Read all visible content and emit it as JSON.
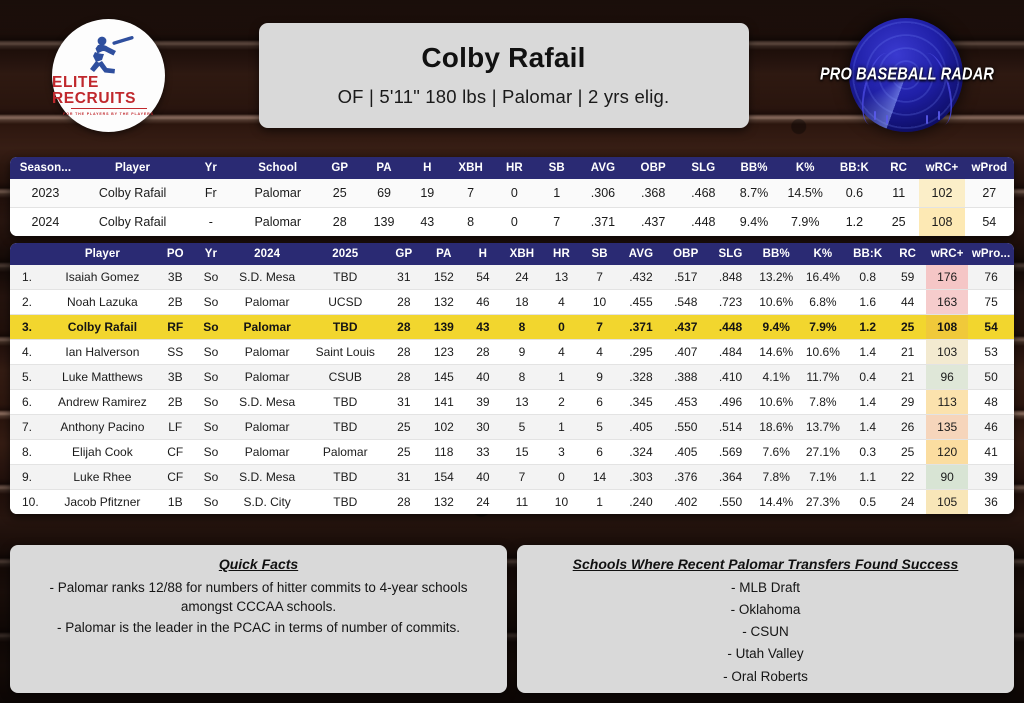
{
  "header": {
    "player_name": "Colby Rafail",
    "player_meta": "OF  |  5'11\"  180 lbs  |  Palomar  | 2 yrs elig.",
    "left_logo": {
      "title": "ELITE RECRUITS",
      "tagline": "FOR THE PLAYERS BY THE PLAYERS"
    },
    "right_logo": {
      "title": "PRO BASEBALL RADAR"
    }
  },
  "season_table": {
    "columns": [
      "Season...",
      "Player",
      "Yr",
      "School",
      "GP",
      "PA",
      "H",
      "XBH",
      "HR",
      "SB",
      "AVG",
      "OBP",
      "SLG",
      "BB%",
      "K%",
      "BB:K",
      "RC",
      "wRC+",
      "wProd"
    ],
    "rows": [
      {
        "cells": [
          "2023",
          "Colby Rafail",
          "Fr",
          "Palomar",
          "25",
          "69",
          "19",
          "7",
          "0",
          "1",
          ".306",
          ".368",
          ".468",
          "8.7%",
          "14.5%",
          "0.6",
          "11",
          "102",
          "27"
        ],
        "wrc_color": "#fbeec8"
      },
      {
        "cells": [
          "2024",
          "Colby Rafail",
          "-",
          "Palomar",
          "28",
          "139",
          "43",
          "8",
          "0",
          "7",
          ".371",
          ".437",
          ".448",
          "9.4%",
          "7.9%",
          "1.2",
          "25",
          "108",
          "54"
        ],
        "wrc_color": "#fde9b4"
      }
    ]
  },
  "rank_table": {
    "columns": [
      "",
      "Player",
      "PO",
      "Yr",
      "2024",
      "2025",
      "GP",
      "PA",
      "H",
      "XBH",
      "HR",
      "SB",
      "AVG",
      "OBP",
      "SLG",
      "BB%",
      "K%",
      "BB:K",
      "RC",
      "wRC+",
      "wPro..."
    ],
    "rows": [
      {
        "highlight": false,
        "wrc_color": "#f5c6c6",
        "cells": [
          "1.",
          "Isaiah Gomez",
          "3B",
          "So",
          "S.D. Mesa",
          "TBD",
          "31",
          "152",
          "54",
          "24",
          "13",
          "7",
          ".432",
          ".517",
          ".848",
          "13.2%",
          "16.4%",
          "0.8",
          "59",
          "176",
          "76"
        ]
      },
      {
        "highlight": false,
        "wrc_color": "#f6cccc",
        "cells": [
          "2.",
          "Noah Lazuka",
          "2B",
          "So",
          "Palomar",
          "UCSD",
          "28",
          "132",
          "46",
          "18",
          "4",
          "10",
          ".455",
          ".548",
          ".723",
          "10.6%",
          "6.8%",
          "1.6",
          "44",
          "163",
          "75"
        ]
      },
      {
        "highlight": true,
        "wrc_color": "#f0c93a",
        "cells": [
          "3.",
          "Colby Rafail",
          "RF",
          "So",
          "Palomar",
          "TBD",
          "28",
          "139",
          "43",
          "8",
          "0",
          "7",
          ".371",
          ".437",
          ".448",
          "9.4%",
          "7.9%",
          "1.2",
          "25",
          "108",
          "54"
        ]
      },
      {
        "highlight": false,
        "wrc_color": "#f3ead0",
        "cells": [
          "4.",
          "Ian Halverson",
          "SS",
          "So",
          "Palomar",
          "Saint Louis",
          "28",
          "123",
          "28",
          "9",
          "4",
          "4",
          ".295",
          ".407",
          ".484",
          "14.6%",
          "10.6%",
          "1.4",
          "21",
          "103",
          "53"
        ]
      },
      {
        "highlight": false,
        "wrc_color": "#dfe7d8",
        "cells": [
          "5.",
          "Luke Matthews",
          "3B",
          "So",
          "Palomar",
          "CSUB",
          "28",
          "145",
          "40",
          "8",
          "1",
          "9",
          ".328",
          ".388",
          ".410",
          "4.1%",
          "11.7%",
          "0.4",
          "21",
          "96",
          "50"
        ]
      },
      {
        "highlight": false,
        "wrc_color": "#fbe2ad",
        "cells": [
          "6.",
          "Andrew Ramirez",
          "2B",
          "So",
          "S.D. Mesa",
          "TBD",
          "31",
          "141",
          "39",
          "13",
          "2",
          "6",
          ".345",
          ".453",
          ".496",
          "10.6%",
          "7.8%",
          "1.4",
          "29",
          "113",
          "48"
        ]
      },
      {
        "highlight": false,
        "wrc_color": "#f6d5bb",
        "cells": [
          "7.",
          "Anthony Pacino",
          "LF",
          "So",
          "Palomar",
          "TBD",
          "25",
          "102",
          "30",
          "5",
          "1",
          "5",
          ".405",
          ".550",
          ".514",
          "18.6%",
          "13.7%",
          "1.4",
          "26",
          "135",
          "46"
        ]
      },
      {
        "highlight": false,
        "wrc_color": "#fbdda0",
        "cells": [
          "8.",
          "Elijah Cook",
          "CF",
          "So",
          "Palomar",
          "Palomar",
          "25",
          "118",
          "33",
          "15",
          "3",
          "6",
          ".324",
          ".405",
          ".569",
          "7.6%",
          "27.1%",
          "0.3",
          "25",
          "120",
          "41"
        ]
      },
      {
        "highlight": false,
        "wrc_color": "#d8e4d4",
        "cells": [
          "9.",
          "Luke Rhee",
          "CF",
          "So",
          "S.D. Mesa",
          "TBD",
          "31",
          "154",
          "40",
          "7",
          "0",
          "14",
          ".303",
          ".376",
          ".364",
          "7.8%",
          "7.1%",
          "1.1",
          "22",
          "90",
          "39"
        ]
      },
      {
        "highlight": false,
        "wrc_color": "#f8e6b8",
        "cells": [
          "10.",
          "Jacob Pfitzner",
          "1B",
          "So",
          "S.D. City",
          "TBD",
          "28",
          "132",
          "24",
          "11",
          "10",
          "1",
          ".240",
          ".402",
          ".550",
          "14.4%",
          "27.3%",
          "0.5",
          "24",
          "105",
          "36"
        ]
      }
    ]
  },
  "quick_facts": {
    "title": "Quick Facts",
    "lines": [
      "- Palomar ranks 12/88 for numbers of hitter commits to 4-year schools amongst CCCAA schools.",
      "- Palomar is the leader in the PCAC in terms of number of commits."
    ]
  },
  "transfers": {
    "title": "Schools Where Recent Palomar Transfers Found Success",
    "lines": [
      "- MLB Draft",
      "- Oklahoma",
      "- CSUN",
      "- Utah Valley",
      "- Oral Roberts"
    ]
  }
}
